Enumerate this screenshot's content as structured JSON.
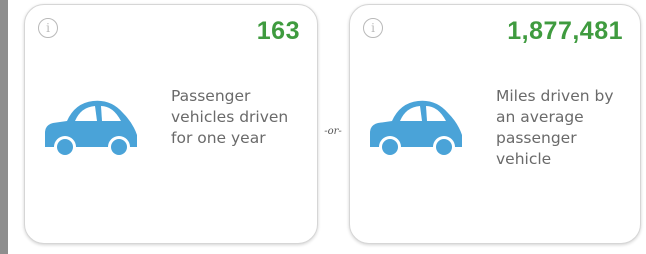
{
  "cards": [
    {
      "info_icon": "info-icon",
      "info_glyph": "i",
      "value": "163",
      "icon": "car-icon",
      "description": "Passenger vehicles driven for one year"
    },
    {
      "info_icon": "info-icon",
      "info_glyph": "i",
      "value": "1,877,481",
      "icon": "car-icon",
      "description": "Miles driven by an average passenger vehicle"
    }
  ],
  "separator": "-or-",
  "colors": {
    "value_green": "#3f9b3f",
    "car_blue": "#4aa3d8",
    "text_gray": "#6a6a6a"
  }
}
